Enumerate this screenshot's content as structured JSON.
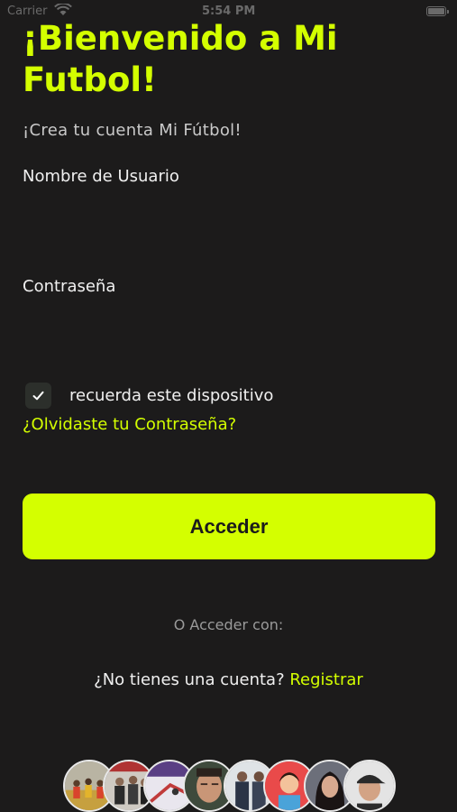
{
  "status_bar": {
    "carrier": "Carrier",
    "time": "5:54 PM"
  },
  "login": {
    "title": "¡Bienvenido a Mi Futbol!",
    "subtitle": "¡Crea tu cuenta Mi Fútbol!",
    "username_label": "Nombre de Usuario",
    "username_value": "",
    "password_label": "Contraseña",
    "password_value": "",
    "remember_label": "recuerda este dispositivo",
    "remember_checked": true,
    "forgot_link": "¿Olvidaste tu Contraseña?",
    "submit_label": "Acceder",
    "alt_login_label": "O Acceder con:",
    "signup_prompt": "¿No tienes una cuenta?",
    "signup_link": "Registrar"
  },
  "colors": {
    "accent": "#d4ff00",
    "background": "#1c1b1b",
    "text": "#f0f0f0",
    "muted": "#9a9a9a"
  },
  "avatars": [
    {
      "name": "team-photo-avatar"
    },
    {
      "name": "group-photo-avatar"
    },
    {
      "name": "stadium-photo-avatar"
    },
    {
      "name": "man-face-avatar"
    },
    {
      "name": "men-standing-avatar"
    },
    {
      "name": "illustrated-person-avatar"
    },
    {
      "name": "woman-portrait-avatar"
    },
    {
      "name": "man-cap-avatar"
    }
  ]
}
